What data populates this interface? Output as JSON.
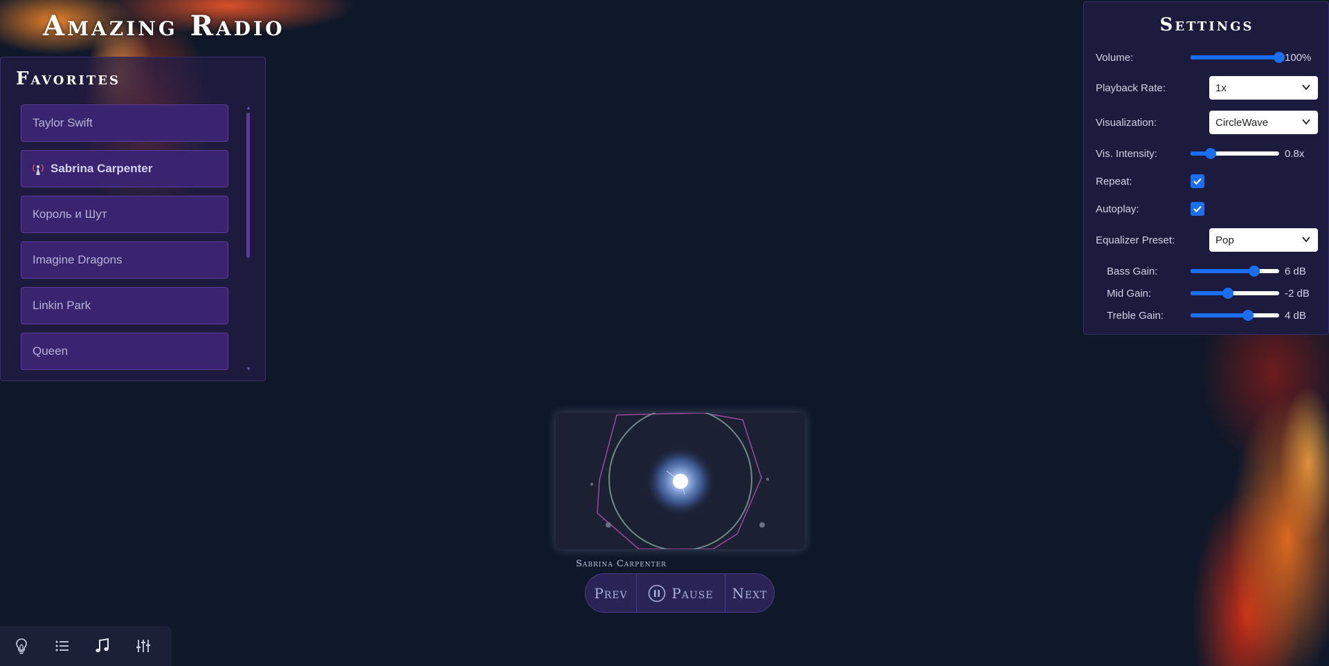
{
  "app": {
    "title": "Amazing Radio"
  },
  "favorites": {
    "title": "Favorites",
    "items": [
      {
        "label": "Taylor Swift",
        "active": false
      },
      {
        "label": "Sabrina Carpenter",
        "active": true
      },
      {
        "label": "Король и Шут",
        "active": false
      },
      {
        "label": "Imagine Dragons",
        "active": false
      },
      {
        "label": "Linkin Park",
        "active": false
      },
      {
        "label": "Queen",
        "active": false
      }
    ]
  },
  "settings": {
    "title": "Settings",
    "volume": {
      "label": "Volume:",
      "value": "100%",
      "level": 1.0
    },
    "playback_rate": {
      "label": "Playback Rate:",
      "value": "1x"
    },
    "visualization": {
      "label": "Visualization:",
      "value": "CircleWave"
    },
    "vis_intensity": {
      "label": "Vis. Intensity:",
      "value": "0.8x",
      "level": 0.23
    },
    "repeat": {
      "label": "Repeat:",
      "checked": true
    },
    "autoplay": {
      "label": "Autoplay:",
      "checked": true
    },
    "equalizer_preset": {
      "label": "Equalizer Preset:",
      "value": "Pop"
    },
    "bass_gain": {
      "label": "Bass Gain:",
      "value": "6 dB",
      "level": 0.72
    },
    "mid_gain": {
      "label": "Mid Gain:",
      "value": "-2 dB",
      "level": 0.42
    },
    "treble_gain": {
      "label": "Treble Gain:",
      "value": "4 dB",
      "level": 0.65
    }
  },
  "player": {
    "now_playing": "Sabrina Carpenter",
    "prev_label": "Prev",
    "pause_label": "Pause",
    "next_label": "Next"
  },
  "toolbar": {
    "icons": [
      "lightbulb-icon",
      "list-icon",
      "music-note-icon",
      "sliders-icon"
    ]
  },
  "colors": {
    "background": "#0f1829",
    "accent": "#1a6ef0",
    "favorite_item": "#3a2470",
    "visualizer_polygon": "#a04aa0",
    "visualizer_circle": "#6f8a88"
  }
}
